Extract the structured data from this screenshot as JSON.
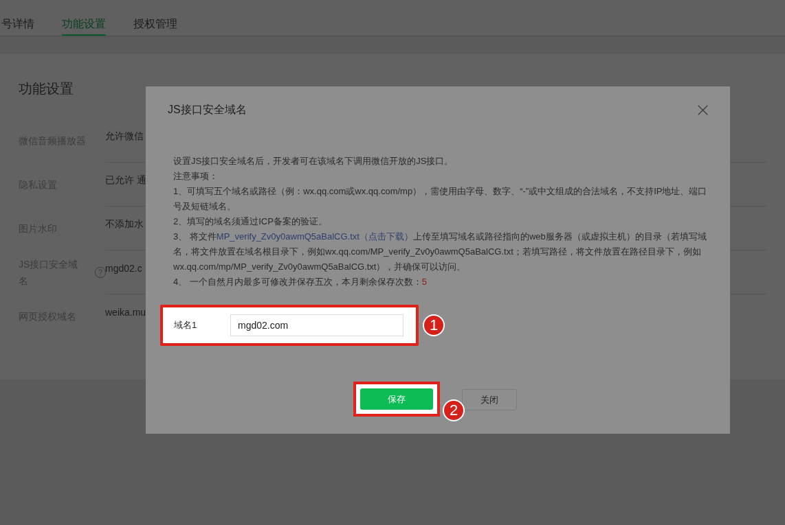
{
  "tabs": [
    {
      "label": "号详情",
      "selected": false
    },
    {
      "label": "功能设置",
      "selected": true
    },
    {
      "label": "授权管理",
      "selected": false
    }
  ],
  "panel": {
    "title": "功能设置",
    "rows": [
      {
        "label": "微信音频播放器",
        "value": "允许微信",
        "help": false
      },
      {
        "label": "隐私设置",
        "value": "已允许 通",
        "help": false
      },
      {
        "label": "图片水印",
        "value": "不添加水",
        "help": false
      },
      {
        "label": "JS接口安全域名",
        "value": "mgd02.c",
        "help": true
      },
      {
        "label": "网页授权域名",
        "value": "weika.mu",
        "help": false
      }
    ]
  },
  "dialog": {
    "title": "JS接口安全域名",
    "intro": "设置JS接口安全域名后，开发者可在该域名下调用微信开放的JS接口。",
    "notes_heading": "注意事项：",
    "note_1": "1、可填写五个域名或路径（例：wx.qq.com或wx.qq.com/mp），需使用由字母、数字、“-”或中文组成的合法域名，不支持IP地址、端口号及短链域名。",
    "note_2": "2、填写的域名须通过ICP备案的验证。",
    "note_3": {
      "before": "3、 将文件",
      "link": "MP_verify_Zv0y0awmQ5aBalCG.txt（点击下载）",
      "after": "上传至填写域名或路径指向的web服务器（或虚拟主机）的目录（若填写域名，将文件放置在域名根目录下，例如wx.qq.com/MP_verify_Zv0y0awmQ5aBalCG.txt；若填写路径，将文件放置在路径目录下，例如wx.qq.com/mp/MP_verify_Zv0y0awmQ5aBalCG.txt），并确保可以访问。"
    },
    "note_4": {
      "text": "4、 一个自然月内最多可修改并保存五次，本月剩余保存次数：",
      "count": "5"
    },
    "field": {
      "label": "域名1",
      "value": "mgd02.com",
      "step": "1"
    },
    "save": {
      "label": "保存",
      "step": "2"
    },
    "close_label": "关闭"
  }
}
